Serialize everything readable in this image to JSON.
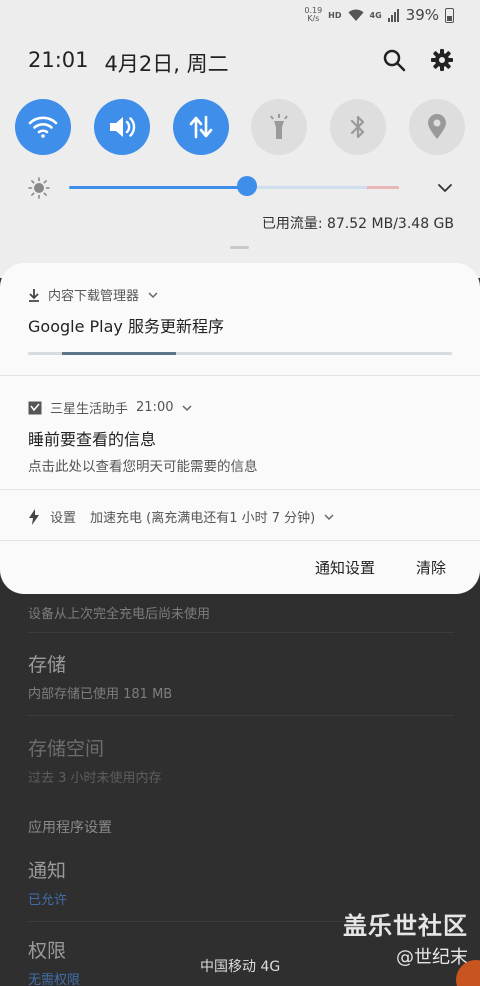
{
  "status_bar": {
    "speed_value": "0.19",
    "speed_unit": "K/s",
    "hd": "HD",
    "network": "4G",
    "battery": "39%"
  },
  "header": {
    "time": "21:01",
    "date": "4月2日, 周二"
  },
  "quick_tiles": [
    {
      "name": "wifi",
      "on": true
    },
    {
      "name": "sound",
      "on": true
    },
    {
      "name": "mobile-data",
      "on": true
    },
    {
      "name": "flashlight",
      "on": false
    },
    {
      "name": "bluetooth",
      "on": false
    },
    {
      "name": "location",
      "on": false
    }
  ],
  "brightness": {
    "level": 0.54
  },
  "data_usage": "已用流量: 87.52 MB/3.48 GB",
  "notifications": {
    "download": {
      "app": "内容下载管理器",
      "title": "Google Play 服务更新程序",
      "progress": 0.35
    },
    "samsung": {
      "app": "三星生活助手",
      "time": "21:00",
      "title": "睡前要查看的信息",
      "body": "点击此处以查看您明天可能需要的信息"
    },
    "settings": {
      "app": "设置",
      "text": "加速充电 (离充满电还有1 小时 7 分钟)"
    },
    "actions": {
      "settings_label": "通知设置",
      "clear_label": "清除"
    }
  },
  "background": {
    "row0_sub": "设备从上次完全充电后尚未使用",
    "storage_title": "存储",
    "storage_sub": "内部存储已使用 181 MB",
    "space_title": "存储空间",
    "space_sub": "过去 3 小时未使用内存",
    "section": "应用程序设置",
    "notify_title": "通知",
    "notify_sub": "已允许",
    "perm_title": "权限",
    "perm_sub": "无需权限"
  },
  "carrier": "中国移动 4G",
  "watermark": {
    "line1": "盖乐世社区",
    "line2": "@世纪末"
  },
  "colors": {
    "accent": "#3f8ee9",
    "panel": "#ededed",
    "card": "#fafafa"
  }
}
